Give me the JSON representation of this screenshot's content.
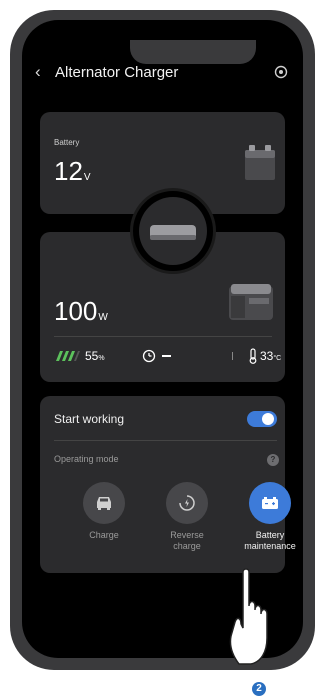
{
  "header": {
    "title": "Alternator Charger",
    "back_icon": "chevron-left-icon",
    "settings_icon": "gear-icon"
  },
  "battery": {
    "label": "Battery",
    "voltage": "12",
    "voltage_unit": "V"
  },
  "output": {
    "power": "100",
    "power_unit": "W"
  },
  "stats": {
    "charge_percent": "55",
    "charge_unit": "%",
    "remaining_time": "—",
    "temperature": "33",
    "temperature_unit": "°C"
  },
  "work": {
    "start_label": "Start working",
    "start_on": true,
    "mode_label": "Operating mode",
    "modes": [
      {
        "label_line1": "Charge",
        "label_line2": "",
        "icon": "car-icon",
        "active": false
      },
      {
        "label_line1": "Reverse",
        "label_line2": "charge",
        "icon": "reverse-charge-icon",
        "active": false
      },
      {
        "label_line1": "Battery",
        "label_line2": "maintenance",
        "icon": "battery-icon",
        "active": true
      }
    ]
  },
  "step_badge": "2",
  "colors": {
    "accent": "#3d7bd9",
    "card": "#2b2b2d",
    "charge_green": "#5cc15c"
  }
}
